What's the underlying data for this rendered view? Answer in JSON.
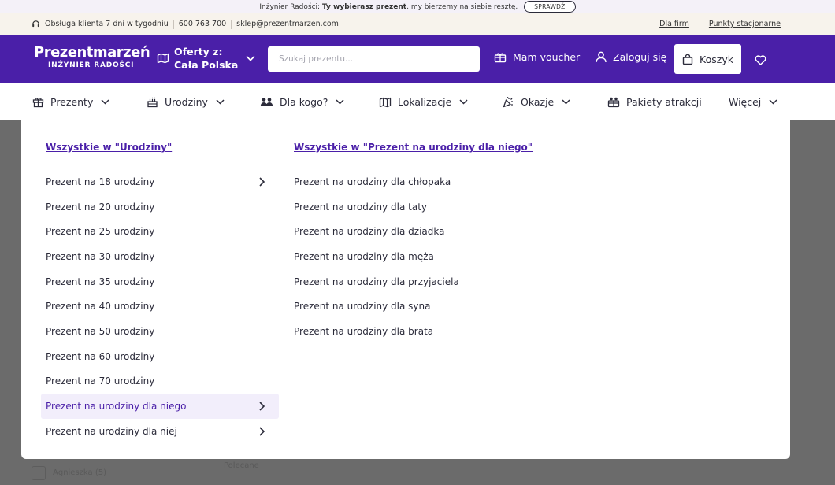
{
  "promo": {
    "prefix": "Inżynier Radości: ",
    "bold": "Ty wybierasz prezent",
    "suffix": ", my bierzemy na siebie resztę.",
    "button": "SPRAWDŹ"
  },
  "info": {
    "service": "Obsługa klienta 7 dni w tygodniu",
    "phone": "600 763 700",
    "email": "sklep@prezentmarzen.com",
    "links": [
      "Dla firm",
      "Punkty stacjonarne"
    ]
  },
  "header": {
    "logo_main": "Prezentmarzeń",
    "logo_sub": "INŻYNIER RADOŚCI",
    "offers_label": "Oferty z:",
    "offers_value": "Cała Polska",
    "search_placeholder": "Szukaj prezentu...",
    "voucher": "Mam voucher",
    "login": "Zaloguj się",
    "cart": "Koszyk",
    "brand_color": "#4a1fa8"
  },
  "nav": {
    "items": [
      {
        "label": "Prezenty",
        "icon": "gift-icon"
      },
      {
        "label": "Urodziny",
        "icon": "cake-icon"
      },
      {
        "label": "Dla kogo?",
        "icon": "people-icon"
      },
      {
        "label": "Lokalizacje",
        "icon": "map-icon"
      },
      {
        "label": "Okazje",
        "icon": "party-icon"
      },
      {
        "label": "Pakiety atrakcji",
        "icon": "gift-pack-icon"
      },
      {
        "label": "Więcej",
        "icon": ""
      }
    ]
  },
  "dropdown": {
    "col1_all": "Wszystkie w \"Urodziny\"",
    "col1_items": [
      "Prezent na 18 urodziny",
      "Prezent na 20 urodziny",
      "Prezent na 25 urodziny",
      "Prezent na 30 urodziny",
      "Prezent na 35 urodziny",
      "Prezent na 40 urodziny",
      "Prezent na 50 urodziny",
      "Prezent na 60 urodziny",
      "Prezent na 70 urodziny",
      "Prezent na urodziny dla niego",
      "Prezent na urodziny dla niej"
    ],
    "col2_all": "Wszystkie w \"Prezent na urodziny dla niego\"",
    "col2_items": [
      "Prezent na urodziny dla chłopaka",
      "Prezent na urodziny dla taty",
      "Prezent na urodziny dla dziadka",
      "Prezent na urodziny dla męża",
      "Prezent na urodziny dla przyjaciela",
      "Prezent na urodziny dla syna",
      "Prezent na urodziny dla brata"
    ]
  },
  "background": {
    "text1": "Agnieszka (5)",
    "text2": "Polecane"
  }
}
